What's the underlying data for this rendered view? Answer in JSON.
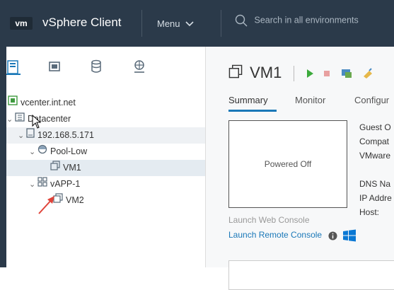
{
  "header": {
    "logo": "vm",
    "app_title": "vSphere Client",
    "menu_label": "Menu",
    "search_placeholder": "Search in all environments"
  },
  "navigator": {
    "tabs": [
      "hosts-and-clusters",
      "vms-and-templates",
      "storage",
      "networking"
    ],
    "tree": [
      {
        "label": "vcenter.int.net",
        "icon": "vcenter-icon"
      },
      {
        "label": "Datacenter",
        "icon": "datacenter-icon"
      },
      {
        "label": "192.168.5.171",
        "icon": "host-icon"
      },
      {
        "label": "Pool-Low",
        "icon": "resource-pool-icon"
      },
      {
        "label": "VM1",
        "icon": "vm-icon"
      },
      {
        "label": "vAPP-1",
        "icon": "vapp-icon"
      },
      {
        "label": "VM2",
        "icon": "vm-icon"
      }
    ]
  },
  "main": {
    "vm_name": "VM1",
    "tabs": [
      "Summary",
      "Monitor",
      "Configur"
    ],
    "console_status": "Powered Off",
    "info_labels": [
      "Guest O",
      "Compat",
      "VMware",
      "DNS Na",
      "IP Addre",
      "Host:"
    ],
    "launch_web_console": "Launch Web Console",
    "launch_remote_console": "Launch Remote Console"
  },
  "colors": {
    "header_bg": "#2b3a4a",
    "accent": "#1a78b8",
    "selected_row": "#e4ebf1",
    "annotation_arrow": "#e0443a"
  }
}
